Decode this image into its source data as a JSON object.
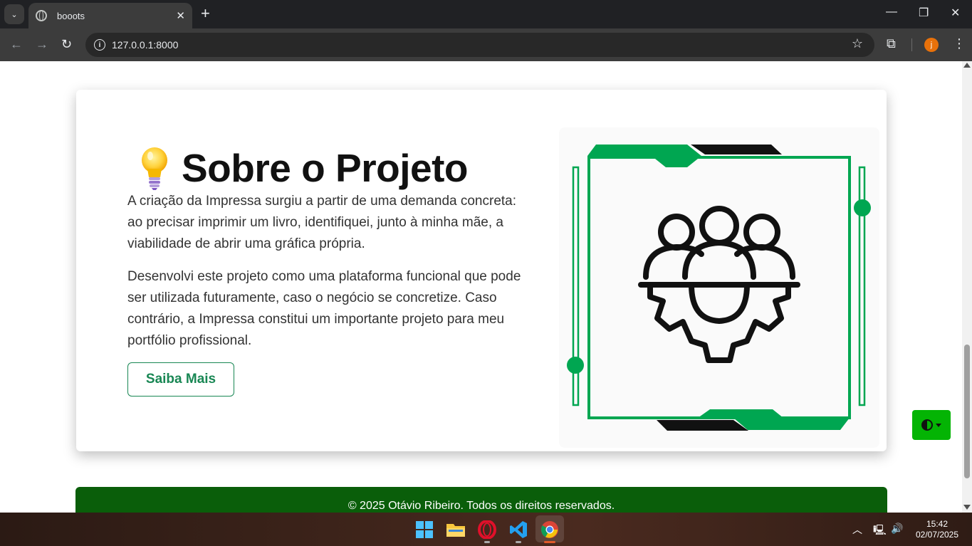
{
  "browser": {
    "tab_title": "booots",
    "url": "127.0.0.1:8000",
    "profile_initial": "j"
  },
  "page": {
    "heading": "Sobre o Projeto",
    "paragraph_1": "A criação da Impressa surgiu a partir de uma demanda concreta: ao precisar imprimir um livro, identifiquei, junto à minha mãe, a viabilidade de abrir uma gráfica própria.",
    "paragraph_2": "Desenvolvi este projeto como uma plataforma funcional que pode ser utilizada futuramente, caso o negócio se concretize. Caso contrário, a Impressa constitui um importante projeto para meu portfólio profissional.",
    "button_label": "Saiba Mais",
    "footer_text": "© 2025 Otávio Ribeiro. Todos os direitos reservados.",
    "accent_color": "#198754",
    "footer_color": "#0a5e0a",
    "image_green": "#00a651"
  },
  "taskbar": {
    "time": "15:42",
    "date": "02/07/2025"
  }
}
